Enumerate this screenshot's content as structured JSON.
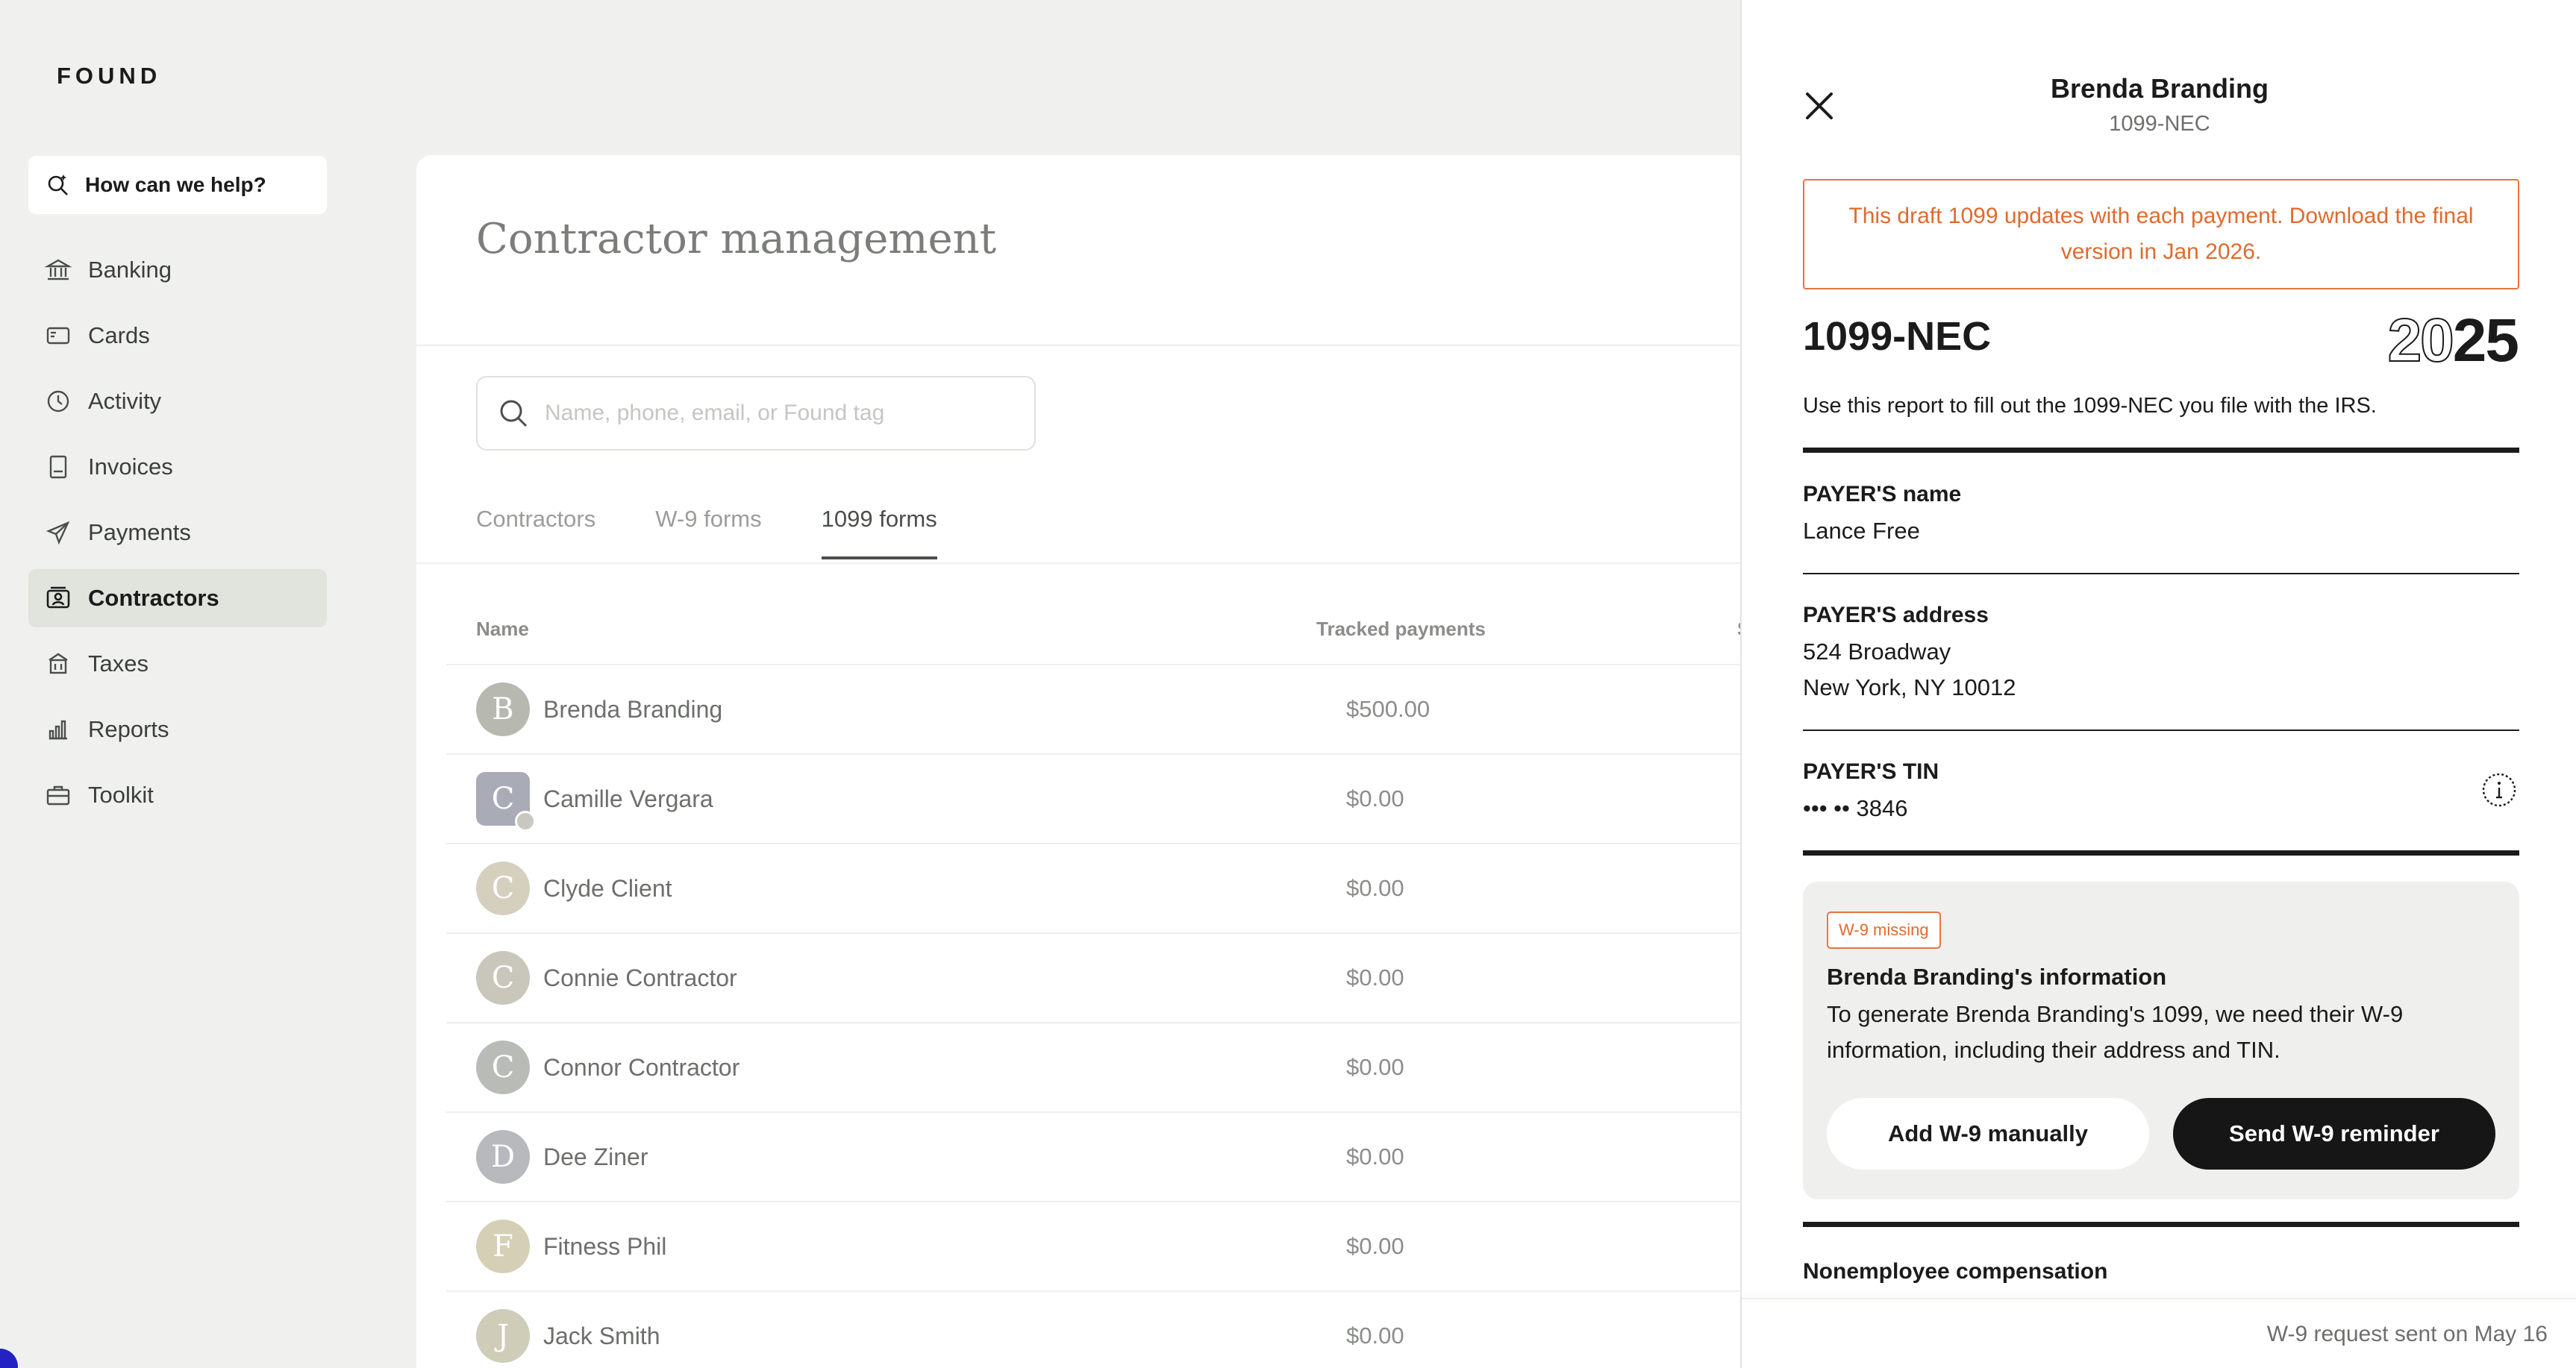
{
  "sidebar": {
    "logo": "FOUND",
    "help_label": "How can we help?",
    "items": [
      {
        "label": "Banking",
        "icon": "bank-icon"
      },
      {
        "label": "Cards",
        "icon": "card-icon"
      },
      {
        "label": "Activity",
        "icon": "clock-icon"
      },
      {
        "label": "Invoices",
        "icon": "invoice-icon"
      },
      {
        "label": "Payments",
        "icon": "send-icon"
      },
      {
        "label": "Contractors",
        "icon": "contractor-icon",
        "active": true
      },
      {
        "label": "Taxes",
        "icon": "taxes-icon"
      },
      {
        "label": "Reports",
        "icon": "reports-icon"
      },
      {
        "label": "Toolkit",
        "icon": "toolkit-icon"
      }
    ]
  },
  "main": {
    "title": "Contractor management",
    "search_placeholder": "Name, phone, email, or Found tag",
    "tabs": [
      {
        "label": "Contractors"
      },
      {
        "label": "W-9 forms"
      },
      {
        "label": "1099 forms",
        "active": true
      }
    ],
    "columns": {
      "name": "Name",
      "tracked": "Tracked payments",
      "status": "S"
    },
    "rows": [
      {
        "initial": "B",
        "name": "Brenda Branding",
        "amount": "$500.00"
      },
      {
        "initial": "C",
        "name": "Camille Vergara",
        "amount": "$0.00"
      },
      {
        "initial": "C",
        "name": "Clyde Client",
        "amount": "$0.00"
      },
      {
        "initial": "C",
        "name": "Connie Contractor",
        "amount": "$0.00"
      },
      {
        "initial": "C",
        "name": "Connor Contractor",
        "amount": "$0.00"
      },
      {
        "initial": "D",
        "name": "Dee Ziner",
        "amount": "$0.00"
      },
      {
        "initial": "F",
        "name": "Fitness Phil",
        "amount": "$0.00"
      },
      {
        "initial": "J",
        "name": "Jack Smith",
        "amount": "$0.00"
      }
    ]
  },
  "drawer": {
    "title": "Brenda Branding",
    "subtitle": "1099-NEC",
    "notice": "This draft 1099 updates with each payment. Download the final version in Jan 2026.",
    "form_name": "1099-NEC",
    "year_outline": "20",
    "year_solid": "25",
    "form_desc": "Use this report to fill out the 1099-NEC you file with the IRS.",
    "payer_name_label": "PAYER'S name",
    "payer_name": "Lance Free",
    "payer_address_label": "PAYER'S address",
    "payer_address_1": "524 Broadway",
    "payer_address_2": "New York, NY 10012",
    "payer_tin_label": "PAYER'S TIN",
    "payer_tin": "••• •• 3846",
    "w9": {
      "badge": "W-9 missing",
      "title": "Brenda Branding's information",
      "text": "To generate Brenda Branding's 1099, we need their W-9 information, including their address and TIN.",
      "add_button": "Add W-9 manually",
      "send_button": "Send W-9 reminder"
    },
    "nec_label": "Nonemployee compensation",
    "footer": "W-9 request sent on May 16"
  },
  "colors": {
    "accent_orange": "#e8743e",
    "primary_button": "#161616",
    "active_nav": "#e1e4dd",
    "background": "#f0f1ef"
  }
}
